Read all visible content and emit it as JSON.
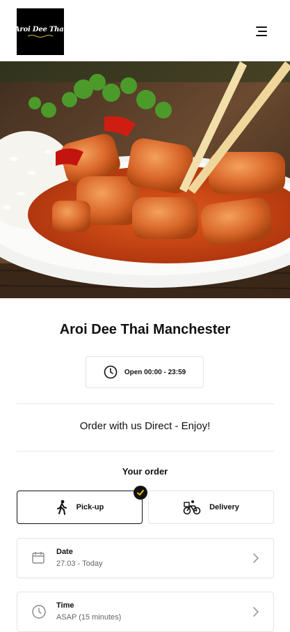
{
  "header": {
    "logo_text": "Aroi Dee Thai",
    "logo_alt": "Aroi Dee Thai logo",
    "menu_icon": "hamburger-menu-icon"
  },
  "hero": {
    "image_alt": "Sweet and sour chicken with rice and chopsticks"
  },
  "restaurant": {
    "name": "Aroi Dee Thai Manchester",
    "hours_label": "Open 00:00 - 23:59",
    "hours_icon": "clock-icon",
    "tagline": "Order with us Direct - Enjoy!"
  },
  "order": {
    "title": "Your order",
    "modes": [
      {
        "label": "Pick-up",
        "icon": "walking-person-icon",
        "selected": true
      },
      {
        "label": "Delivery",
        "icon": "bicycle-courier-icon",
        "selected": false
      }
    ],
    "fields": [
      {
        "label": "Date",
        "value": "27.03 - Today",
        "icon": "calendar-icon"
      },
      {
        "label": "Time",
        "value": "ASAP (15 minutes)",
        "icon": "clock-icon"
      }
    ]
  },
  "colors": {
    "text": "#111111",
    "muted": "#666666",
    "border": "#e4e4e4",
    "logo_bg": "#000000"
  }
}
